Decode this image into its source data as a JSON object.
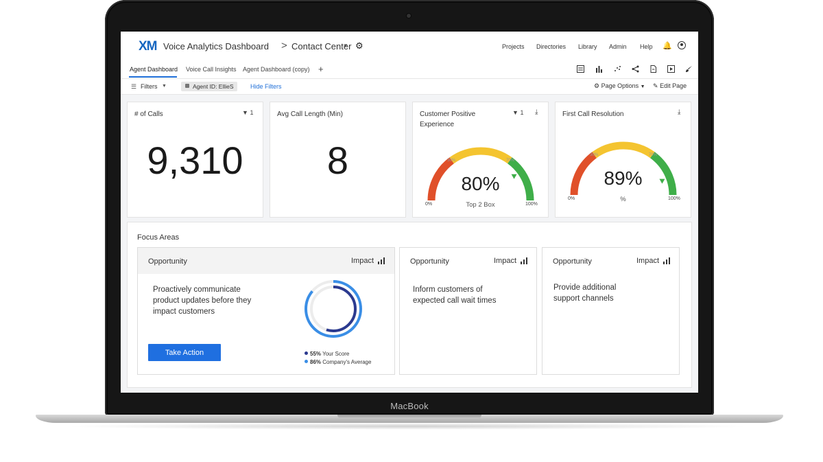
{
  "device": {
    "brand_label": "MacBook"
  },
  "header": {
    "logo": "XM",
    "title": "Voice Analytics Dashboard",
    "breadcrumb_sep": ">",
    "project": "Contact Center",
    "nav": [
      "Projects",
      "Directories",
      "Library",
      "Admin",
      "Help"
    ]
  },
  "tabs": {
    "items": [
      "Agent Dashboard",
      "Voice Call Insights",
      "Agent Dashboard (copy)"
    ],
    "active": 0,
    "add": "+"
  },
  "filters": {
    "label": "Filters",
    "chip": "Agent ID: EllieS",
    "hide": "Hide Filters",
    "page_options": "Page Options",
    "edit_page": "Edit Page"
  },
  "widgets": {
    "calls": {
      "title": "# of Calls",
      "filter_count": "1",
      "value": "9,310"
    },
    "avg_length": {
      "title": "Avg Call Length (Min)",
      "value": "8"
    },
    "cpe": {
      "title": "Customer Positive\nExperience",
      "filter_count": "1",
      "value": "80%",
      "sub": "Top 2 Box",
      "min": "0%",
      "max": "100%",
      "tick_low": "30%",
      "tick_high": "70%",
      "level": 0.8
    },
    "fcr": {
      "title": "First Call Resolution",
      "value": "89%",
      "sub": "%",
      "min": "0%",
      "max": "100%",
      "tick_low": "30%",
      "tick_high": "70%",
      "level": 0.89
    }
  },
  "gauge_colors": {
    "low": "#e0502a",
    "mid": "#f4c430",
    "high": "#3fae49"
  },
  "focus": {
    "title": "Focus Areas",
    "cards": [
      {
        "label": "Opportunity",
        "impact": "Impact",
        "text": "Proactively communicate\nproduct updates before they\nimpact customers",
        "button": "Take Action",
        "your_score_pct": "55%",
        "your_score_label": "Your Score",
        "company_pct": "86%",
        "company_label": "Company's Average",
        "your_score": 0.55,
        "company_avg": 0.86
      },
      {
        "label": "Opportunity",
        "impact": "Impact",
        "text": "Inform customers of\nexpected call wait times"
      },
      {
        "label": "Opportunity",
        "impact": "Impact",
        "text": "Provide additional\nsupport channels"
      }
    ]
  },
  "colors": {
    "accent": "#1f6fe0",
    "score_dark": "#2b3a8f",
    "score_light": "#3a8ee6"
  }
}
